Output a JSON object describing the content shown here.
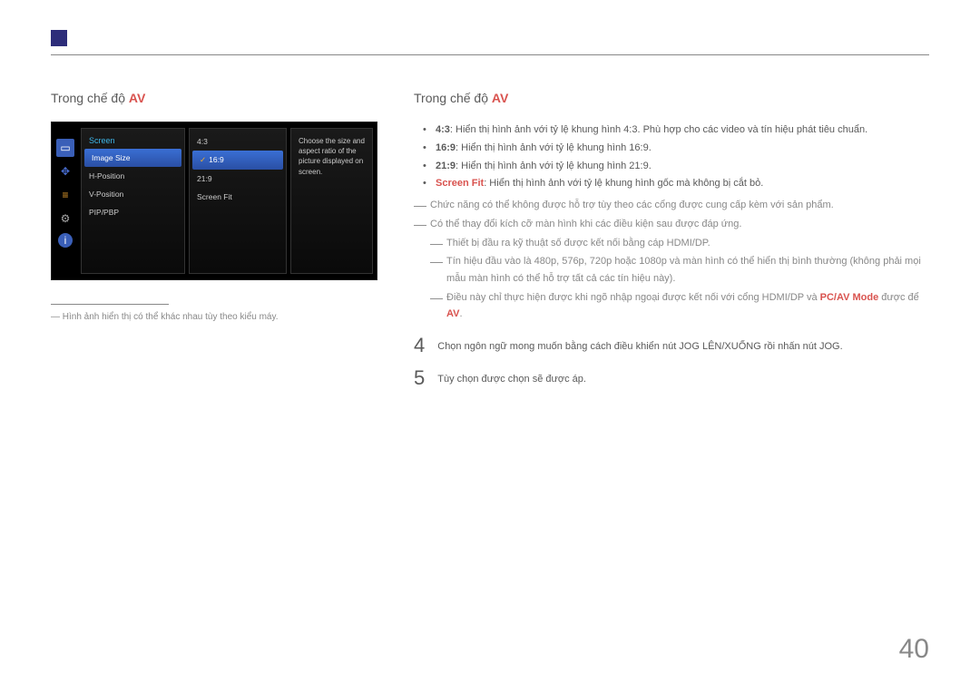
{
  "header": {
    "left_title_prefix": "Trong chế độ ",
    "left_title_accent": "AV",
    "right_title_prefix": "Trong chế độ ",
    "right_title_accent": "AV"
  },
  "osd": {
    "menu_title": "Screen",
    "menu_items": [
      "Image Size",
      "H-Position",
      "V-Position",
      "PIP/PBP"
    ],
    "submenu_items": [
      "4:3",
      "16:9",
      "21:9",
      "Screen Fit"
    ],
    "description": "Choose the size and aspect ratio of the picture displayed on screen.",
    "icon_names": [
      "monitor-icon",
      "joystick-icon",
      "bars-icon",
      "gear-icon",
      "info-icon"
    ]
  },
  "footnote": "Hình ảnh hiển thị có thể khác nhau tùy theo kiểu máy.",
  "bullets": [
    {
      "label": "4:3",
      "text": ": Hiển thị hình ảnh với tỷ lệ khung hình 4:3. Phù hợp cho các video và tín hiệu phát tiêu chuẩn.",
      "accent": false
    },
    {
      "label": "16:9",
      "text": ": Hiển thị hình ảnh với tỷ lệ khung hình 16:9.",
      "accent": false
    },
    {
      "label": "21:9",
      "text": ": Hiển thị hình ảnh với tỷ lệ khung hình 21:9.",
      "accent": false
    },
    {
      "label": "Screen Fit",
      "text": ": Hiển thị hình ảnh với tỷ lệ khung hình gốc mà không bị cắt bỏ.",
      "accent": true
    }
  ],
  "dash_notes": {
    "line1": "Chức năng có thể không được hỗ trợ tùy theo các cổng được cung cấp kèm với sản phẩm.",
    "line2": "Có thể thay đổi kích cỡ màn hình khi các điều kiện sau được đáp ứng.",
    "sub1": "Thiết bị đầu ra kỹ thuật số được kết nối bằng cáp HDMI/DP.",
    "sub2": "Tín hiệu đầu vào là 480p, 576p, 720p hoặc 1080p và màn hình có thể hiển thị bình thường (không phải mọi mẫu màn hình có thể hỗ trợ tất cả các tín hiệu này).",
    "sub3_prefix": "Điều này chỉ thực hiện được khi ngõ nhập ngoại được kết nối với cổng HDMI/DP và ",
    "sub3_mode": "PC/AV Mode",
    "sub3_mid": " được để ",
    "sub3_av": "AV",
    "sub3_end": "."
  },
  "steps": {
    "s4_num": "4",
    "s4_text": "Chọn ngôn ngữ mong muốn bằng cách điều khiển nút JOG LÊN/XUỐNG rồi nhấn nút JOG.",
    "s5_num": "5",
    "s5_text": "Tùy chọn được chọn sẽ được áp."
  },
  "page_number": "40"
}
